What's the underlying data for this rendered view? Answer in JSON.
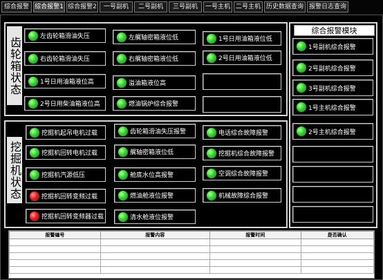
{
  "tabs": [
    {
      "label": "综合报警",
      "active": false
    },
    {
      "label": "综合报警1",
      "active": true
    },
    {
      "label": "综合报警2",
      "active": false
    },
    {
      "label": "一号副机",
      "active": false
    },
    {
      "label": "二号副机",
      "active": false
    },
    {
      "label": "三号副机",
      "active": false
    },
    {
      "label": "一号主机",
      "active": false
    },
    {
      "label": "二号主机",
      "active": false
    },
    {
      "label": "历史数据查询",
      "active": false
    },
    {
      "label": "报警日志查询",
      "active": false
    }
  ],
  "gearbox": {
    "title": "齿轮箱状态",
    "items": [
      {
        "label": "左齿轮箱滑油失压",
        "status": "green"
      },
      {
        "label": "右齿轮箱滑油失压",
        "status": "green"
      },
      {
        "label": "1号日用油箱液位高",
        "status": "green"
      },
      {
        "label": "2号日用柴油箱液位高",
        "status": "green"
      },
      {
        "label": "左艉轴密箱液位低",
        "status": "green"
      },
      {
        "label": "右艉轴密箱液位低",
        "status": "green"
      },
      {
        "label": "溢油箱液位高",
        "status": "green"
      },
      {
        "label": "燃油锅炉综合报警",
        "status": "green"
      },
      {
        "label": "1号日用油箱液位低",
        "status": "green"
      },
      {
        "label": "2号日用油箱液位低",
        "status": "green"
      },
      {
        "label": "",
        "status": "none"
      },
      {
        "label": "",
        "status": "none"
      }
    ]
  },
  "excavator": {
    "title": "挖掘机状态",
    "items": [
      {
        "label": "挖掘机起吊电机过载",
        "status": "green"
      },
      {
        "label": "挖掘机回转电机过载",
        "status": "green"
      },
      {
        "label": "挖掘机汽源低压",
        "status": "green"
      },
      {
        "label": "挖掘机回转变频过载",
        "status": "red"
      },
      {
        "label": "挖掘机回转变频器过载",
        "status": "red"
      },
      {
        "label": "齿轮箱滑油失压报警",
        "status": "green"
      },
      {
        "label": "艉轴密箱液位低",
        "status": "green"
      },
      {
        "label": "舱底水位高报警",
        "status": "green"
      },
      {
        "label": "燃油舱液位报警",
        "status": "green"
      },
      {
        "label": "清水舱液位报警",
        "status": "green"
      },
      {
        "label": "电话综合故障报警",
        "status": "green"
      },
      {
        "label": "挖掘机综合故障报警",
        "status": "green"
      },
      {
        "label": "空调综合故障报警",
        "status": "green"
      },
      {
        "label": "机械故障综合报警",
        "status": "green"
      }
    ]
  },
  "alarm_module": {
    "title": "综合报警模块",
    "items": [
      {
        "label": "1号副机综合报警",
        "status": "green"
      },
      {
        "label": "2号副机综合报警",
        "status": "green"
      },
      {
        "label": "3号副机综合报警",
        "status": "green"
      },
      {
        "label": "1号主机综合报警",
        "status": "green"
      },
      {
        "label": "2号主机综合报警",
        "status": "green"
      },
      {
        "label": "",
        "status": "none"
      },
      {
        "label": "",
        "status": "none"
      },
      {
        "label": "",
        "status": "none"
      },
      {
        "label": "",
        "status": "none"
      }
    ]
  },
  "alarm_table": {
    "headers": [
      "报警编号",
      "报警内容",
      "报警时间",
      "是否确认"
    ],
    "rows": [
      [
        "",
        "",
        "",
        ""
      ],
      [
        "",
        "",
        "",
        ""
      ],
      [
        "",
        "",
        "",
        ""
      ],
      [
        "",
        "",
        "",
        ""
      ],
      [
        "",
        "",
        "",
        ""
      ]
    ]
  }
}
